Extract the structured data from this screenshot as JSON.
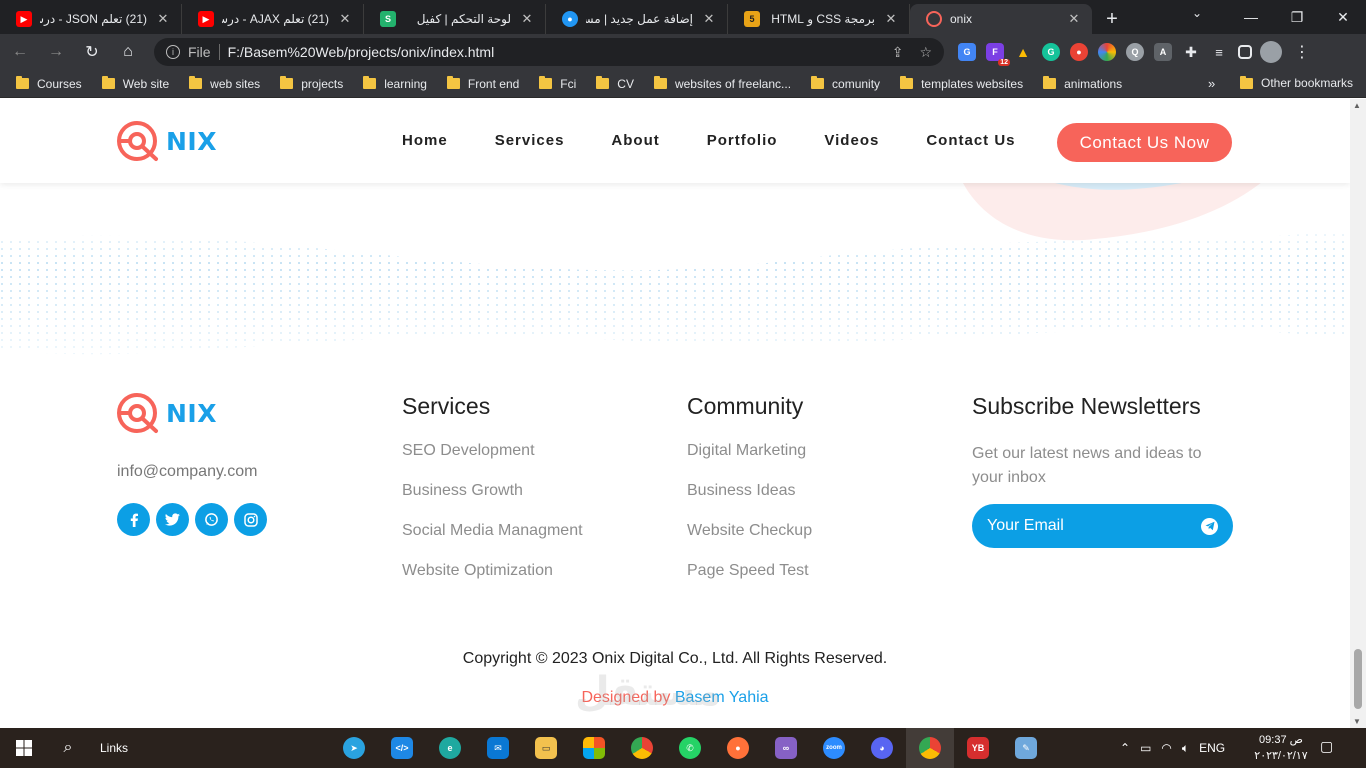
{
  "browser": {
    "tabs": [
      {
        "title": "(21) تعلم JSON - درس",
        "favicon": "youtube-icon",
        "color": "#ff0000"
      },
      {
        "title": "(21) تعلم AJAX - درس",
        "favicon": "youtube-icon",
        "color": "#ff0000"
      },
      {
        "title": "لوحة التحكم | كفيل",
        "favicon": "kafiil-icon",
        "color": "#23b26d"
      },
      {
        "title": "إضافة عمل جديد | مستقل",
        "favicon": "mostaql-icon",
        "color": "#2196f3"
      },
      {
        "title": "برمجة CSS و HTML | خد",
        "favicon": "html5-icon",
        "color": "#e8a317"
      },
      {
        "title": "onix",
        "favicon": "onix-icon",
        "color": "#f7645a"
      }
    ],
    "file_label": "File",
    "url": "F:/Basem%20Web/projects/onix/index.html",
    "bookmarks": [
      "Courses",
      "Web site",
      "web sites",
      "projects",
      "learning",
      "Front end",
      "Fci",
      "CV",
      "websites of freelanc...",
      "comunity",
      "templates websites",
      "animations"
    ],
    "other_bookmarks": "Other bookmarks",
    "more": "»",
    "extension_badge": "12"
  },
  "site": {
    "logo_text": "NIX",
    "nav": [
      "Home",
      "Services",
      "About",
      "Portfolio",
      "Videos",
      "Contact Us"
    ],
    "cta": "Contact Us Now",
    "colors": {
      "accent": "#f7645a",
      "brand": "#1aa0e8",
      "button": "#0c9fe5"
    }
  },
  "footer": {
    "email": "info@company.com",
    "social": [
      "facebook-icon",
      "twitter-icon",
      "whatsapp-icon",
      "instagram-icon"
    ],
    "services": {
      "title": "Services",
      "items": [
        "SEO Development",
        "Business Growth",
        "Social Media Managment",
        "Website Optimization"
      ]
    },
    "community": {
      "title": "Community",
      "items": [
        "Digital Marketing",
        "Business Ideas",
        "Website Checkup",
        "Page Speed Test"
      ]
    },
    "newsletter": {
      "title": "Subscribe Newsletters",
      "text": "Get our latest news and ideas to your inbox",
      "placeholder": "Your Email"
    },
    "copyright": "Copyright © 2023 Onix Digital Co., Ltd. All Rights Reserved.",
    "designed_by": "Designed by",
    "designer": "Basem Yahia"
  },
  "watermark": "مستقل",
  "taskbar": {
    "links": "Links",
    "lang": "ENG",
    "time": "09:37 ص",
    "date": "٢٠٢٣/٠٢/١٧"
  }
}
